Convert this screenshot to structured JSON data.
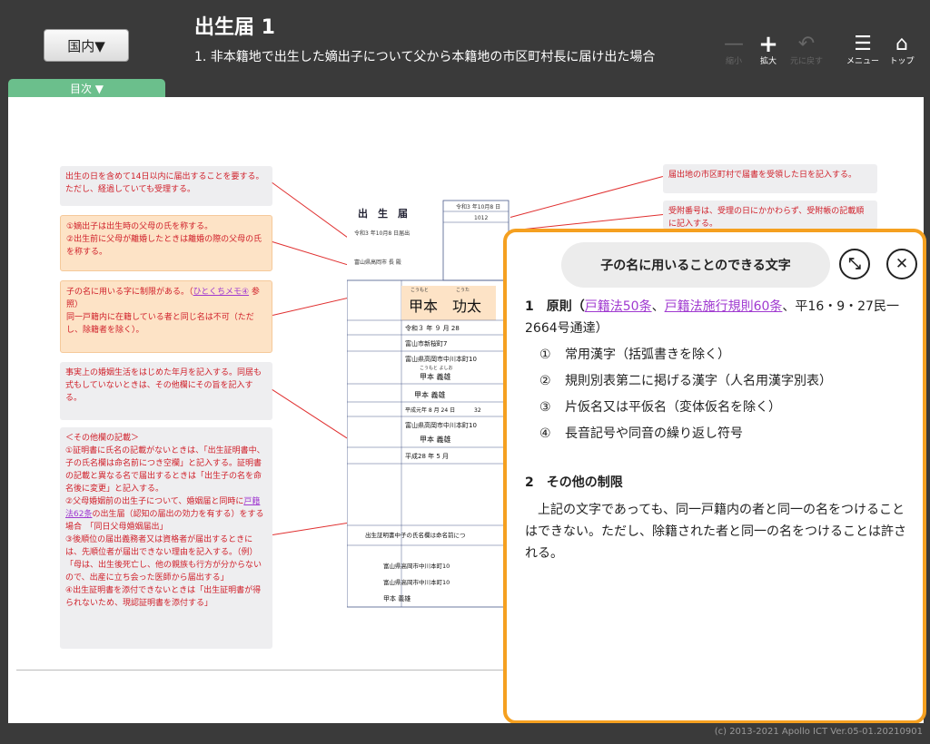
{
  "header": {
    "region_button": "国内▼",
    "title": "出生届 1",
    "subtitle": "1. 非本籍地で出生した嫡出子について父から本籍地の市区町村長に届け出た場合",
    "tools": {
      "shrink": "縮小",
      "zoom": "拡大",
      "back": "元に戻す",
      "menu": "メニュー",
      "top": "トップ"
    }
  },
  "toc_tab": "目次 ▼",
  "notes": {
    "n1": "出生の日を含めて14日以内に届出することを要する。ただし、経過していても受理する。",
    "n2_l1": "①嫡出子は出生時の父母の氏を称する。",
    "n2_l2": "②出生前に父母が離婚したときは離婚の際の父母の氏を称する。",
    "n3_pre": "子の名に用いる字に制限がある。（",
    "n3_link": "ひとくちメモ④",
    "n3_post": " 参照）",
    "n3_l2": "同一戸籍内に在籍している者と同じ名は不可（ただし、除籍者を除く）。",
    "n4": "事実上の婚姻生活をはじめた年月を記入する。同居も式もしていないときは、その他欄にその旨を記入する。",
    "n5_head": "＜その他欄の記載＞",
    "n5_l1": "①証明書に氏名の記載がないときは、「出生証明書中、子の氏名欄は命名前につき空欄」と記入する。証明書の記載と異なる名で届出するときは「出生子の名を命名後に変更」と記入する。",
    "n5_l2_pre": "②父母婚姻前の出生子について、婚姻届と同時に",
    "n5_l2_link": "戸籍法62条",
    "n5_l2_post": "の出生届（認知の届出の効力を有する）をする場合　「同日父母婚姻届出」",
    "n5_l3": "③後順位の届出義務者又は資格者が届出するときには、先順位者が届出できない理由を記入する。（例）「母は、出生後死亡し、他の親族も行方が分からないので、出産に立ち会った医師から届出する」",
    "n5_l4": "④出生証明書を添付できないときは「出生証明書が得られないため、現認証明書を添付する」",
    "r1": "届出地の市区町村で届書を受領した日を記入する。",
    "r2": "受附番号は、受理の日にかかわらず、受附帳の記載順に記入する。"
  },
  "form": {
    "title": "出　生　届",
    "date": "令和3 年10月8 日届出",
    "office": "富山県高岡市 長 殿",
    "recv_date": "令和3 年10月8 日",
    "recv_no": "1012",
    "furi_sei": "こうもと",
    "furi_mei": "こうた",
    "child_sei": "甲本",
    "child_mei": "功太",
    "birth_date": "令和３ 年 ９ 月 28",
    "birth_place": "富山市新桜町7",
    "address": "富山県高岡市中川本町10",
    "furi_father": "こうもと よしお",
    "head": "甲本 義雄",
    "father": "甲本 義雄",
    "father_birth": "平成元年 8 月 24 日",
    "father_age": "32",
    "honseki": "富山県高岡市中川本町10",
    "honseki_head": "甲本 義雄",
    "cohab": "平成28 年 5 月",
    "other": "出生証明書中子の氏名欄は命名前につ",
    "notifier_addr": "富山県高岡市中川本町10",
    "notifier_honseki": "富山県高岡市中川本町10",
    "notifier_name": "甲本 義雄"
  },
  "popup": {
    "title": "子の名に用いることのできる文字",
    "s1_head": "1　原則（",
    "s1_link1": "戸籍法50条",
    "s1_sep": "、",
    "s1_link2": "戸籍法施行規則60条",
    "s1_tail": "、平16・9・27民一2664号通達）",
    "items": [
      {
        "num": "①",
        "text": "常用漢字（括弧書きを除く）"
      },
      {
        "num": "②",
        "text": "規則別表第二に掲げる漢字（人名用漢字別表）"
      },
      {
        "num": "③",
        "text": "片仮名又は平仮名（変体仮名を除く）"
      },
      {
        "num": "④",
        "text": "長音記号や同音の繰り返し符号"
      }
    ],
    "s2_head": "2　その他の制限",
    "s2_body": "上記の文字であっても、同一戸籍内の者と同一の名をつけることはできない。ただし、除籍された者と同一の名をつけることは許される。"
  },
  "footer": {
    "copyright": "(c) 2013-2021 Apollo ICT  Ver.05-01.20210901"
  },
  "colors": {
    "accent_orange": "#f5a020",
    "toc_green": "#6bbf8c",
    "note_red": "#d0202a",
    "link_purple": "#a03ad0"
  }
}
